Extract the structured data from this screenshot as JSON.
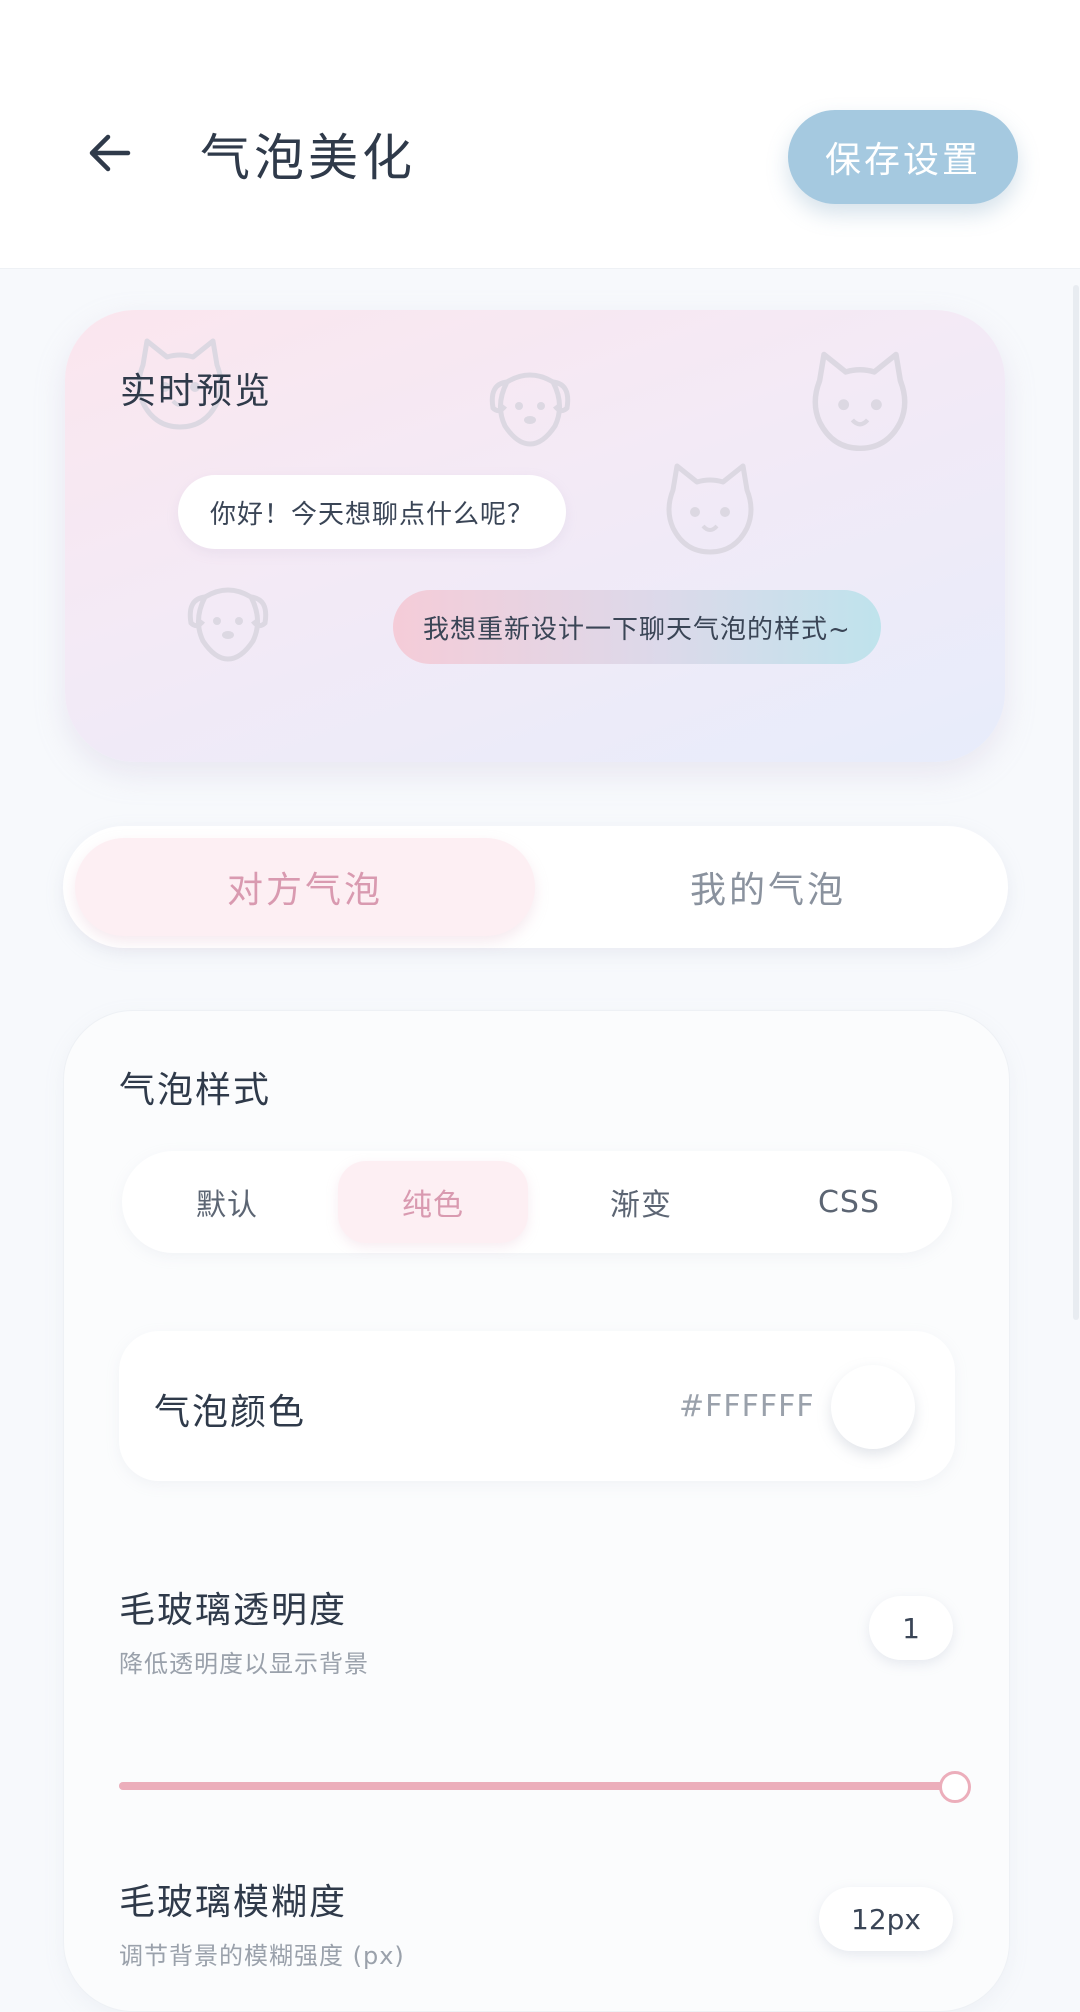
{
  "header": {
    "title": "气泡美化",
    "save_label": "保存设置",
    "back_icon": "arrow-left-icon"
  },
  "preview": {
    "title": "实时预览",
    "incoming_message": "你好！今天想聊点什么呢？",
    "outgoing_message": "我想重新设计一下聊天气泡的样式~",
    "background_icons": [
      "cat-face-icon",
      "dog-face-icon",
      "cat-face-icon",
      "cat-face-icon",
      "dog-face-icon"
    ]
  },
  "tabs": {
    "items": [
      {
        "label": "对方气泡",
        "active": true
      },
      {
        "label": "我的气泡",
        "active": false
      }
    ]
  },
  "bubble_style": {
    "section_title": "气泡样式",
    "options": [
      {
        "label": "默认",
        "active": false
      },
      {
        "label": "纯色",
        "active": true
      },
      {
        "label": "渐变",
        "active": false
      },
      {
        "label": "CSS",
        "active": false
      }
    ]
  },
  "bubble_color": {
    "label": "气泡颜色",
    "hex": "#FFFFFF",
    "swatch_color": "#FFFFFF"
  },
  "glass_opacity": {
    "title": "毛玻璃透明度",
    "description": "降低透明度以显示背景",
    "value": "1",
    "slider_fraction": 1.0
  },
  "glass_blur": {
    "title": "毛玻璃模糊度",
    "description": "调节背景的模糊强度 (px)",
    "value": "12px"
  },
  "colors": {
    "accent_pink": "#ECAEBB",
    "save_button": "#A5C9E0",
    "active_tab_text": "#D99AB0"
  }
}
